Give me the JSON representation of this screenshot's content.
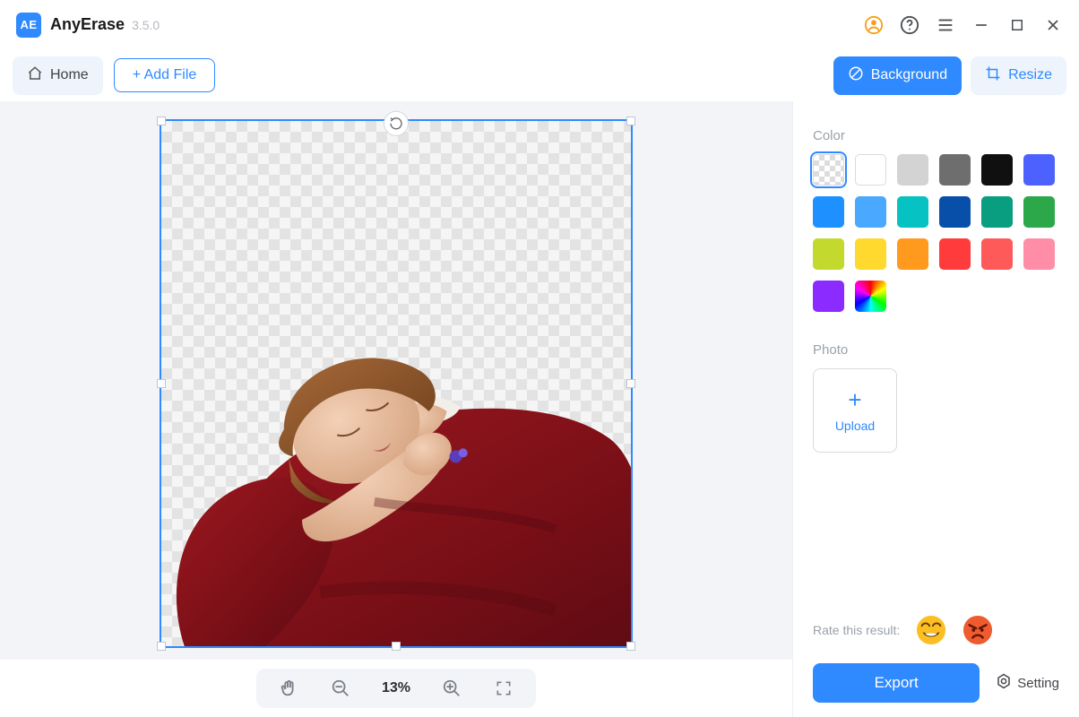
{
  "app": {
    "logoText": "AE",
    "name": "AnyErase",
    "version": "3.5.0"
  },
  "toolbar": {
    "home": "Home",
    "addFile": "+ Add File",
    "background": "Background",
    "resize": "Resize"
  },
  "zoom": {
    "value": "13%"
  },
  "panel": {
    "colorLabel": "Color",
    "photoLabel": "Photo",
    "uploadLabel": "Upload",
    "rateLabel": "Rate this result:",
    "exportLabel": "Export",
    "settingLabel": "Setting",
    "colors": [
      {
        "id": "transparent",
        "type": "trans",
        "selected": true
      },
      {
        "id": "white",
        "hex": "#ffffff"
      },
      {
        "id": "light-gray",
        "hex": "#d3d3d3"
      },
      {
        "id": "gray",
        "hex": "#6e6e6e"
      },
      {
        "id": "black",
        "hex": "#101010"
      },
      {
        "id": "indigo",
        "hex": "#4d61ff"
      },
      {
        "id": "blue",
        "hex": "#1e90ff"
      },
      {
        "id": "sky",
        "hex": "#4aa9ff"
      },
      {
        "id": "cyan",
        "hex": "#06c2c2"
      },
      {
        "id": "navy",
        "hex": "#074fa8"
      },
      {
        "id": "teal",
        "hex": "#0a9e80"
      },
      {
        "id": "green",
        "hex": "#2ca84a"
      },
      {
        "id": "lime",
        "hex": "#c4d92e"
      },
      {
        "id": "yellow",
        "hex": "#ffd92e"
      },
      {
        "id": "orange",
        "hex": "#ff9a1e"
      },
      {
        "id": "red",
        "hex": "#ff3b3b"
      },
      {
        "id": "coral",
        "hex": "#ff5a5a"
      },
      {
        "id": "pink",
        "hex": "#ff8da8"
      },
      {
        "id": "purple",
        "hex": "#8b2bff"
      },
      {
        "id": "rainbow",
        "type": "rainbow"
      }
    ]
  }
}
